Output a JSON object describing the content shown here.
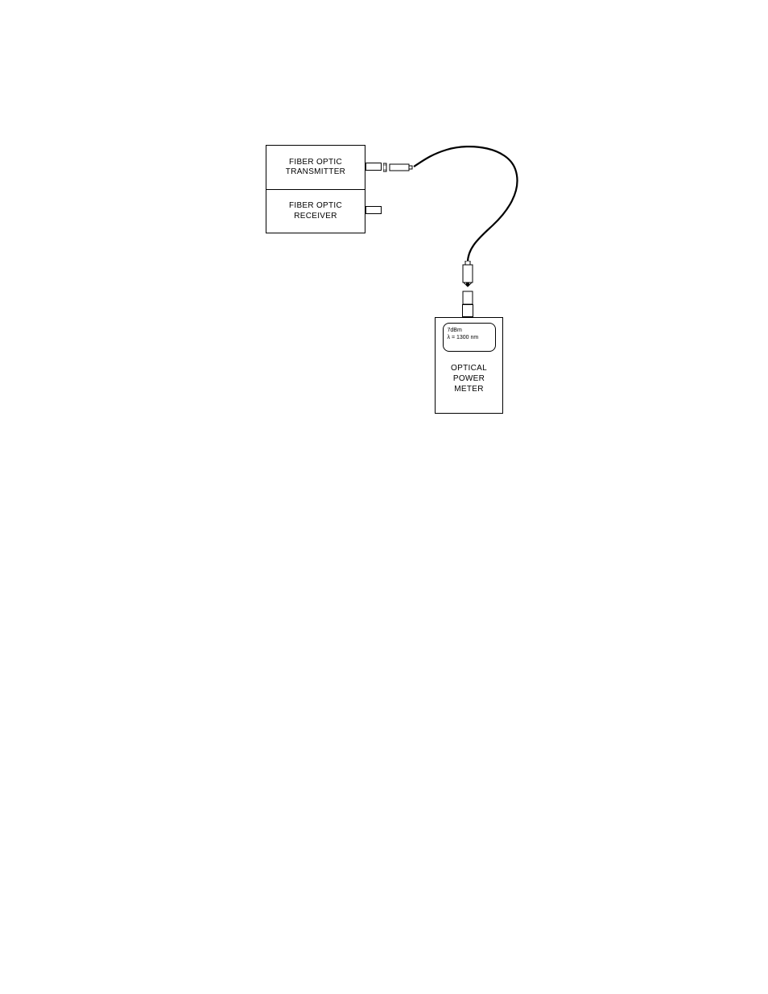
{
  "transceiver": {
    "tx_line1": "FIBER OPTIC",
    "tx_line2": "TRANSMITTER",
    "rx_line1": "FIBER OPTIC",
    "rx_line2": "RECEIVER"
  },
  "meter": {
    "reading_line1": "7dBm",
    "reading_line2": "λ = 1300 nm",
    "label_line1": "OPTICAL",
    "label_line2": "POWER",
    "label_line3": "METER"
  }
}
